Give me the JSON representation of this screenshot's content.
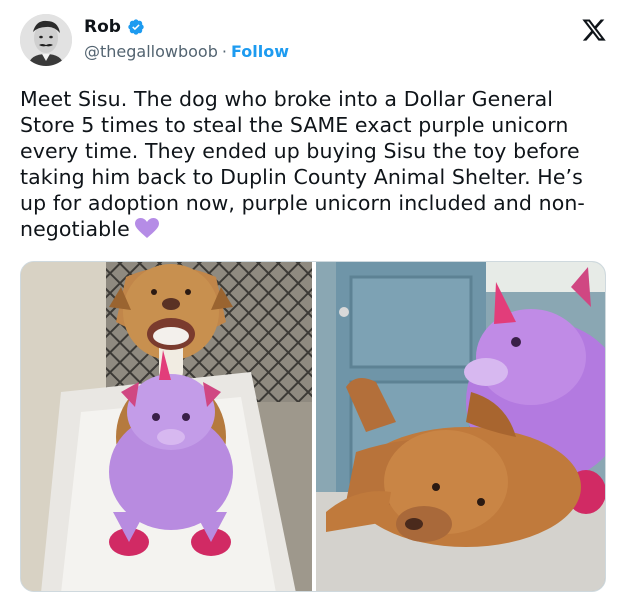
{
  "user": {
    "display_name": "Rob",
    "handle": "@thegallowboob",
    "separator": "·",
    "follow_label": "Follow",
    "verified": true
  },
  "tweet": {
    "text": "Meet Sisu. The dog who broke into a Dollar General Store 5 times to steal the SAME exact purple unicorn every time. They ended up buying Sisu the toy before taking him back to Duplin County Animal Shelter. He’s up for adoption now, purple unicorn included and non-negotiable",
    "emoji": "purple-heart-icon"
  },
  "icons": {
    "verified": "verified-badge-icon",
    "platform": "x-logo-icon"
  },
  "colors": {
    "accent": "#1d9bf0",
    "text": "#0f1419",
    "secondary_text": "#536471",
    "heart": "#b58ce6"
  },
  "media": {
    "count": 2,
    "items": [
      "photo",
      "photo"
    ]
  }
}
